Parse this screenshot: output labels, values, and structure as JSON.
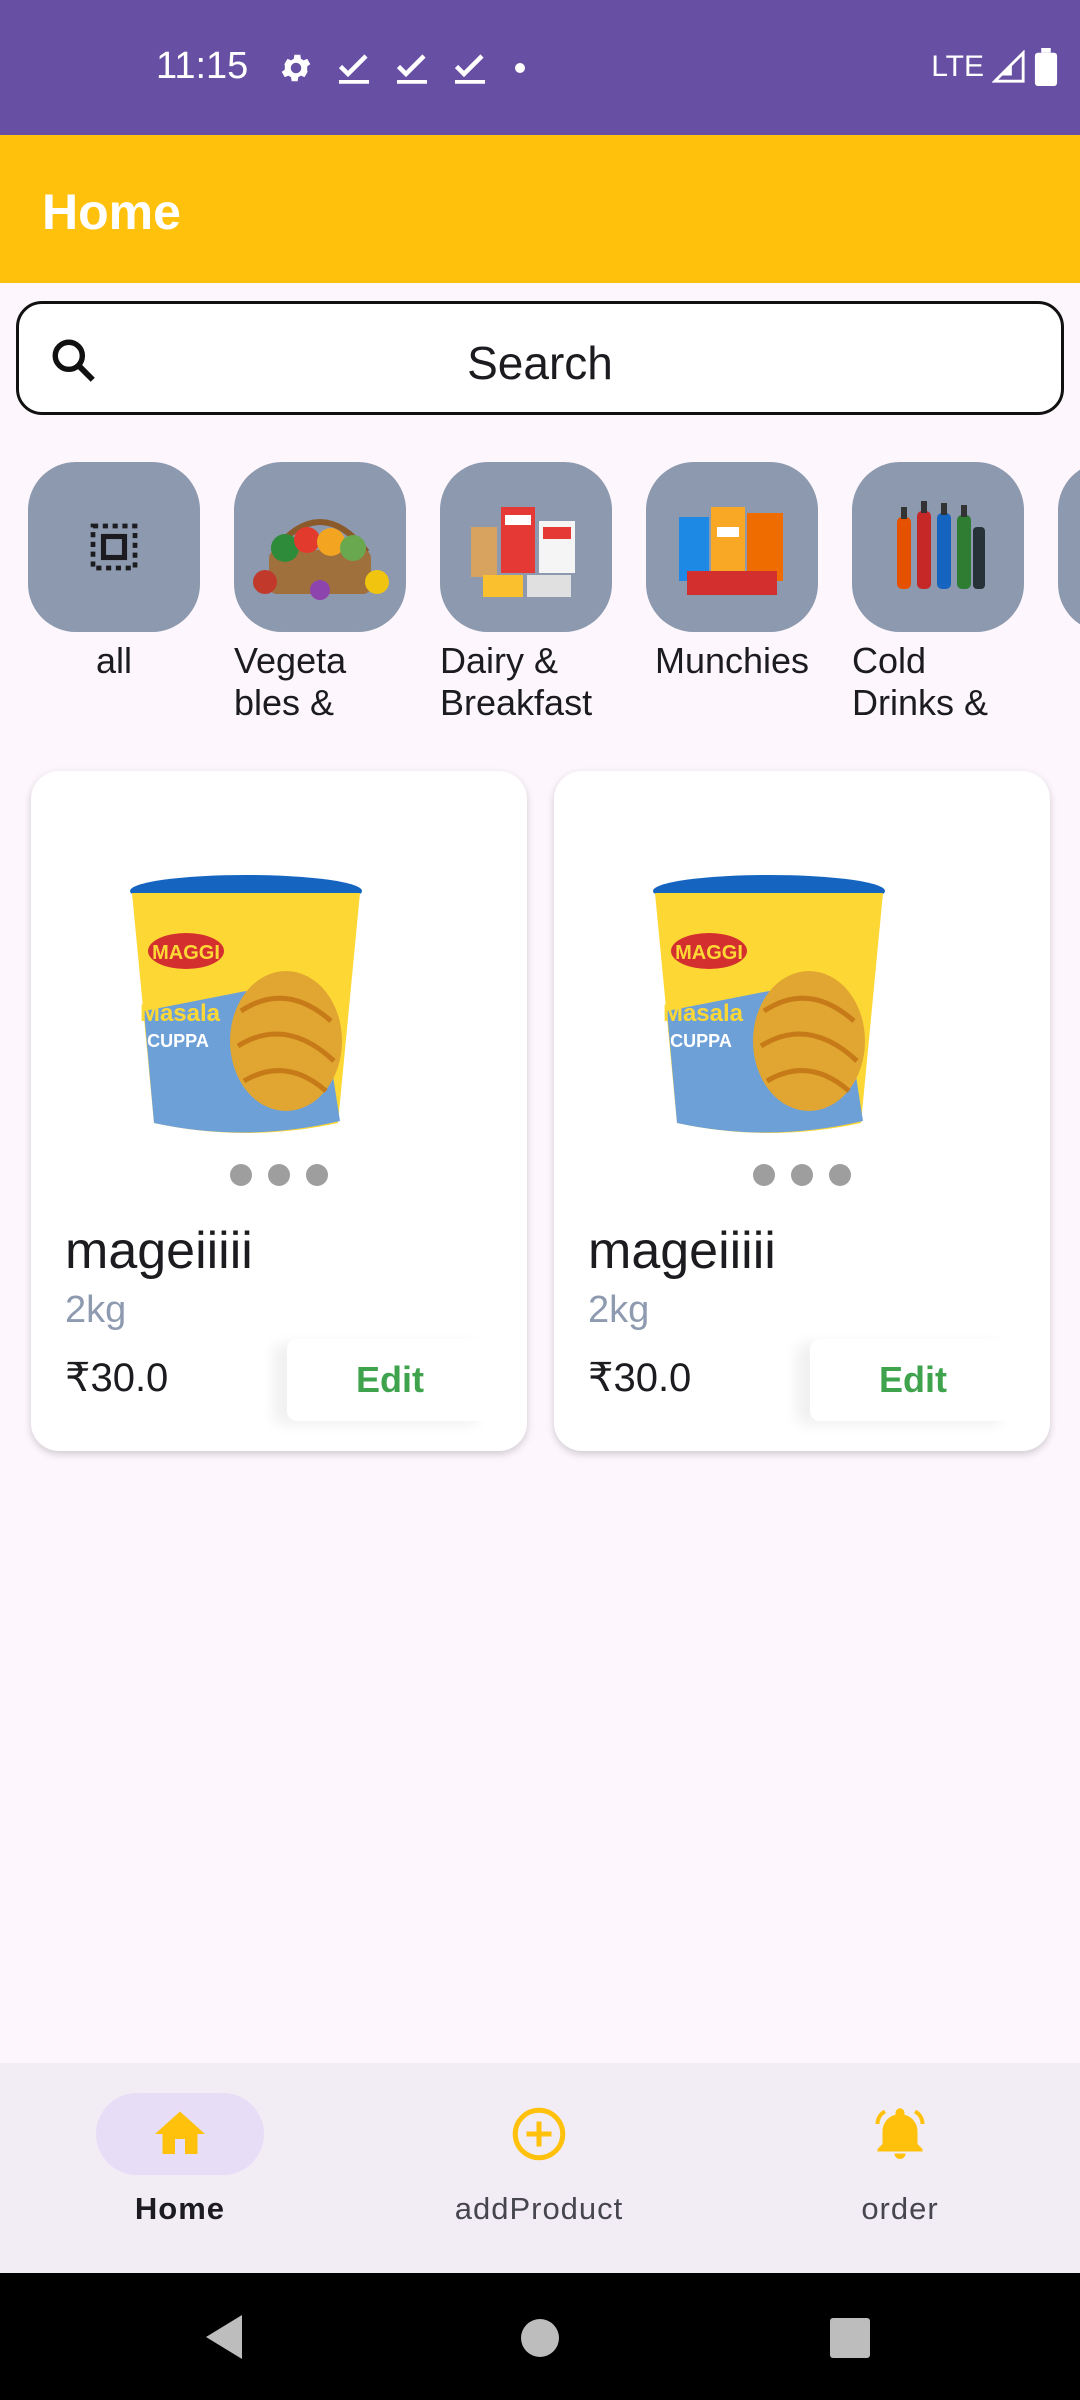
{
  "status_bar": {
    "time": "11:15",
    "network": "LTE",
    "icons": [
      "gear-icon",
      "check-icon",
      "check-icon",
      "check-icon",
      "dot-icon",
      "signal-icon",
      "battery-icon"
    ]
  },
  "app_bar": {
    "title": "Home"
  },
  "search": {
    "placeholder": "Search",
    "icon": "search-icon"
  },
  "categories": [
    {
      "label": "all",
      "icon": "select-all-icon"
    },
    {
      "label": "Vegeta bles & Fr...",
      "image": "vegetables-image"
    },
    {
      "label": "Dairy & Breakfast",
      "image": "dairy-image"
    },
    {
      "label": "Munchies",
      "image": "munchies-image"
    },
    {
      "label": "Cold Drinks & ...",
      "image": "cold-drinks-image"
    }
  ],
  "products": [
    {
      "name": "mageiiiii",
      "quantity": "2kg",
      "price": "₹30.0",
      "edit_label": "Edit",
      "image": "maggi-cup-image"
    },
    {
      "name": "mageiiiii",
      "quantity": "2kg",
      "price": "₹30.0",
      "edit_label": "Edit",
      "image": "maggi-cup-image"
    }
  ],
  "bottom_nav": [
    {
      "label": "Home",
      "icon": "home-icon",
      "active": true
    },
    {
      "label": "addProduct",
      "icon": "add-circle-icon",
      "active": false
    },
    {
      "label": "order",
      "icon": "bell-icon",
      "active": false
    }
  ],
  "colors": {
    "status_bar": "#6750a4",
    "app_bar": "#ffc10c",
    "accent_icon": "#ffc10c",
    "edit_text": "#3fa34d",
    "category_bg": "#8c99ae"
  }
}
